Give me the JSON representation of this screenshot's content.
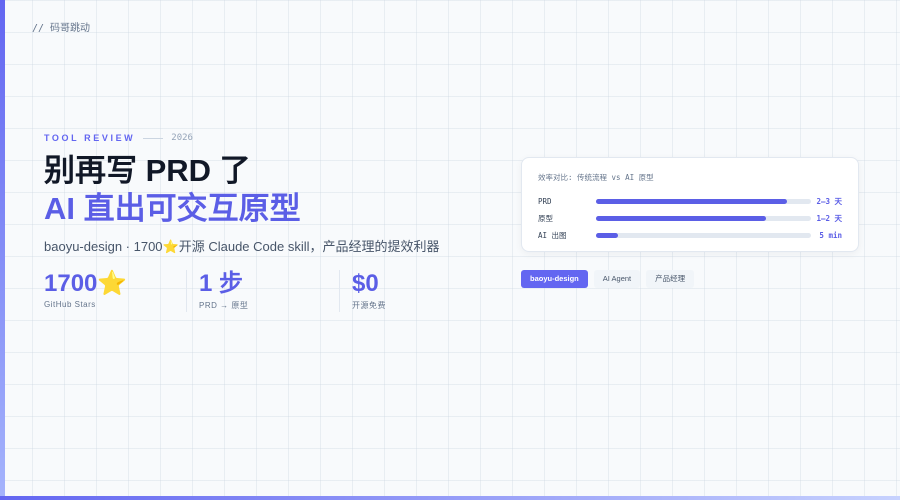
{
  "brand": "// 码哥跳动",
  "eyebrow": {
    "label": "TOOL REVIEW",
    "year": "2026"
  },
  "headline": {
    "line1": "别再写 PRD 了",
    "line2": "AI 直出可交互原型"
  },
  "subtitle": "baoyu-design · 1700⭐开源 Claude Code skill，产品经理的提效利器",
  "stats": [
    {
      "value": "1700⭐",
      "label": "GitHub Stars"
    },
    {
      "value": "1 步",
      "label": "PRD → 原型"
    },
    {
      "value": "$0",
      "label": "开源免费"
    }
  ],
  "comparison": {
    "title": "效率对比: 传统流程 vs AI 原型",
    "rows": [
      {
        "label": "PRD",
        "value": "2–3 天",
        "fill": 0.89
      },
      {
        "label": "原型",
        "value": "1–2 天",
        "fill": 0.79
      },
      {
        "label": "AI 出图",
        "value": "5 min",
        "fill": 0.1
      }
    ]
  },
  "tags": [
    {
      "label": "baoyu-design",
      "primary": true
    },
    {
      "label": "AI Agent",
      "primary": false
    },
    {
      "label": "产品经理",
      "primary": false
    }
  ],
  "colors": {
    "accent": "#6366f1",
    "heading": "#111827",
    "muted": "#64748b"
  }
}
